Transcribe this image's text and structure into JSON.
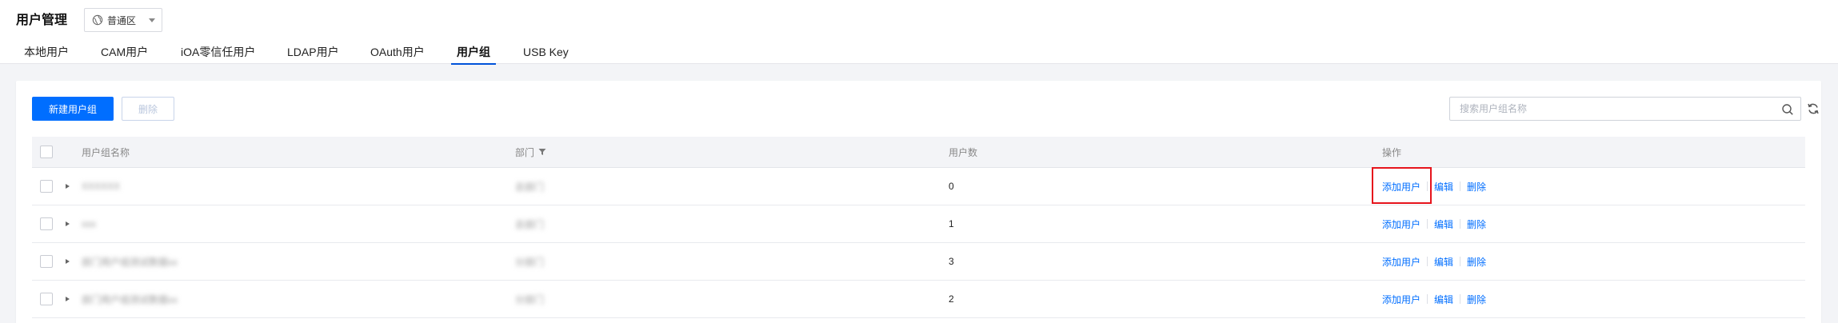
{
  "header": {
    "title": "用户管理",
    "region": "普通区"
  },
  "tabs": [
    {
      "label": "本地用户",
      "active": false
    },
    {
      "label": "CAM用户",
      "active": false
    },
    {
      "label": "iOA零信任用户",
      "active": false
    },
    {
      "label": "LDAP用户",
      "active": false
    },
    {
      "label": "OAuth用户",
      "active": false
    },
    {
      "label": "用户组",
      "active": true
    },
    {
      "label": "USB Key",
      "active": false
    }
  ],
  "toolbar": {
    "create_label": "新建用户组",
    "delete_label": "删除",
    "search_placeholder": "搜索用户组名称"
  },
  "table": {
    "columns": [
      "用户组名称",
      "部门",
      "用户数",
      "操作"
    ],
    "rows": [
      {
        "name": "XXXXXX",
        "dept": "总部门",
        "count": "0"
      },
      {
        "name": "xxx",
        "dept": "总部门",
        "count": "1"
      },
      {
        "name": "部门用户组测试数据xx",
        "dept": "分部门",
        "count": "3"
      },
      {
        "name": "部门用户组测试数据xx",
        "dept": "分部门",
        "count": "2"
      }
    ],
    "actions": {
      "add_user": "添加用户",
      "edit": "编辑",
      "delete": "删除"
    }
  },
  "colors": {
    "primary": "#006eff",
    "highlight": "#e6141c"
  },
  "icons": {
    "region": "globe-icon",
    "search": "search-icon",
    "refresh": "refresh-icon",
    "filter": "filter-icon"
  }
}
